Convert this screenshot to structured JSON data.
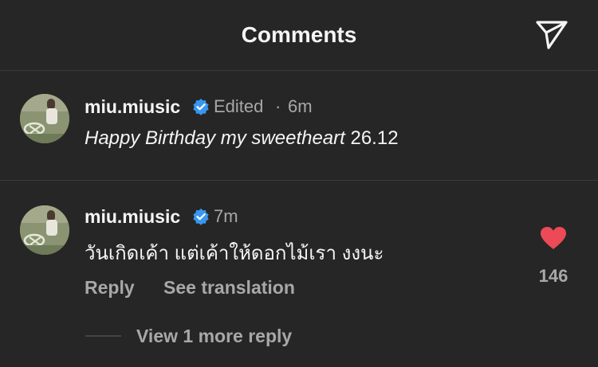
{
  "header": {
    "title": "Comments",
    "icons": [
      "send-icon"
    ]
  },
  "comments": [
    {
      "username": "miu.miusic",
      "verified": true,
      "edited": "Edited",
      "separator": "·",
      "time": "6m",
      "text_italic": "Happy Birthday my sweetheart",
      "text_regular": "26.12"
    },
    {
      "username": "miu.miusic",
      "verified": true,
      "time": "7m",
      "text": "วันเกิดเค้า แต่เค้าให้ดอกไม้เรา งงนะ",
      "reply_label": "Reply",
      "translate_label": "See translation",
      "likes": "146",
      "view_replies": "View 1 more reply"
    }
  ],
  "colors": {
    "background": "#262626",
    "text": "#f5f5f5",
    "secondary": "#a8a8a8",
    "verified": "#3897f0",
    "heart": "#ed4956"
  }
}
